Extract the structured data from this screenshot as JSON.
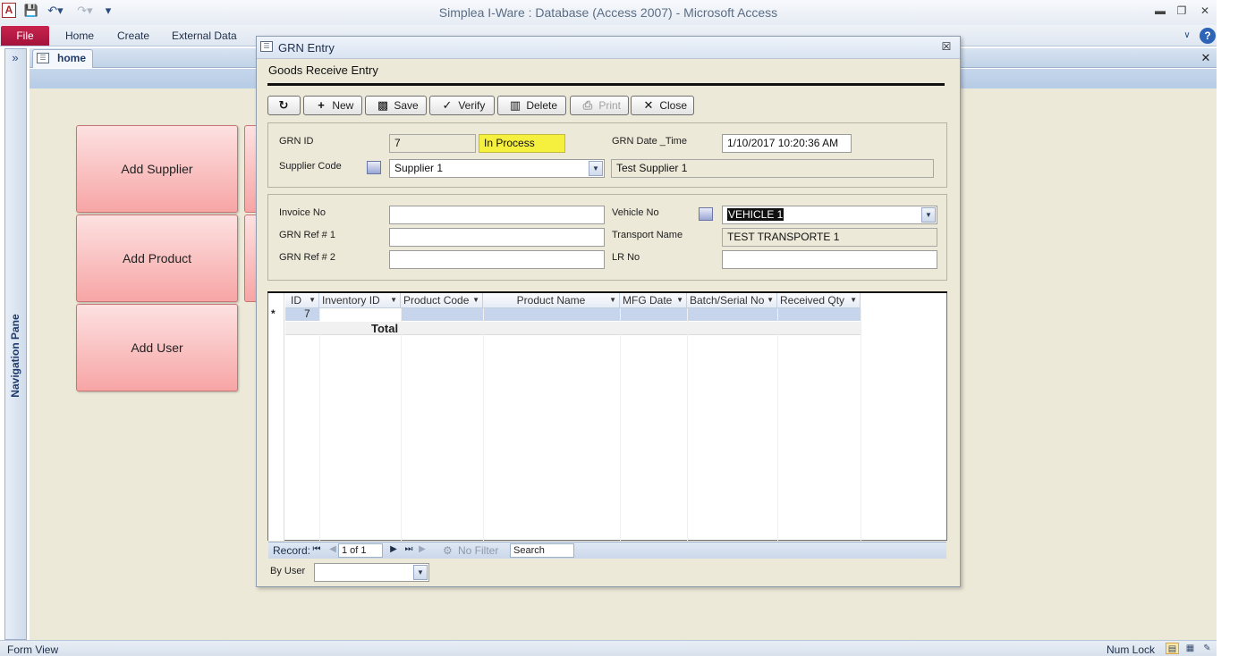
{
  "window": {
    "title": "Simplea I-Ware : Database (Access 2007)  -  Microsoft Access",
    "app_icon_letter": "A"
  },
  "ribbon": {
    "file_label": "File",
    "tabs": [
      "Home",
      "Create",
      "External Data"
    ]
  },
  "nav_pane": {
    "label": "Navigation Pane"
  },
  "document_tab": {
    "label": "home"
  },
  "home_buttons": [
    "Add Supplier",
    "Add Product",
    "Add User"
  ],
  "dialog": {
    "title": "GRN Entry",
    "heading": "Goods Receive Entry",
    "toolbar": {
      "new_label": "New",
      "save_label": "Save",
      "verify_label": "Verify",
      "delete_label": "Delete",
      "print_label": "Print",
      "close_label": "Close"
    },
    "header_section": {
      "grn_id_label": "GRN ID",
      "grn_id_value": "7",
      "status_value": "In Process",
      "grn_datetime_label": "GRN Date _Time",
      "grn_datetime_value": "1/10/2017 10:20:36 AM",
      "supplier_code_label": "Supplier Code",
      "supplier_code_value": "Supplier 1",
      "supplier_name_value": "Test Supplier 1"
    },
    "invoice_section": {
      "invoice_no_label": "Invoice No",
      "invoice_no_value": "",
      "grn_ref1_label": "GRN Ref # 1",
      "grn_ref1_value": "",
      "grn_ref2_label": "GRN Ref # 2",
      "grn_ref2_value": "",
      "vehicle_no_label": "Vehicle No",
      "vehicle_no_value": "VEHICLE 1",
      "transport_name_label": "Transport Name",
      "transport_name_value": "TEST TRANSPORTE 1",
      "lr_no_label": "LR No",
      "lr_no_value": ""
    },
    "grid": {
      "columns": [
        "ID",
        "Inventory ID",
        "Product Code",
        "Product Name",
        "MFG Date",
        "Batch/Serial No",
        "Received Qty"
      ],
      "new_row_marker": "*",
      "new_row_id": "7",
      "total_label": "Total"
    },
    "record_nav": {
      "record_label": "Record:",
      "position": "1 of 1",
      "filter_label": "No Filter",
      "search_label": "Search"
    },
    "by_user": {
      "label": "By User",
      "value": ""
    }
  },
  "status_bar": {
    "left_text": "Form View",
    "numlock_text": "Num Lock"
  }
}
